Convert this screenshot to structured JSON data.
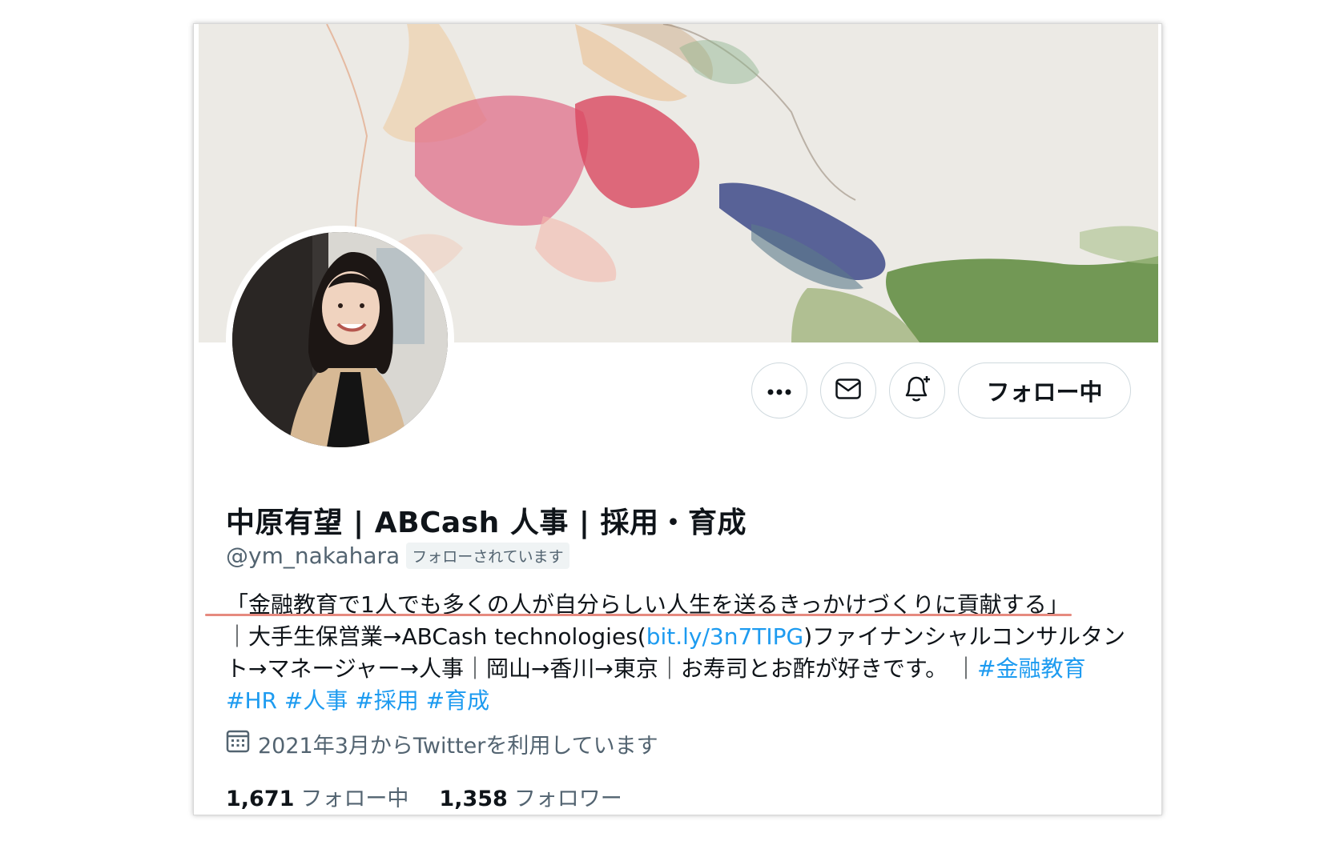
{
  "profile": {
    "display_name": "中原有望 | ABCash 人事 | 採用・育成",
    "handle": "@ym_nakahara",
    "follows_you_badge": "フォローされています",
    "follow_button_label": "フォロー中"
  },
  "actions": {
    "more_icon": "more-horizontal-icon",
    "message_icon": "envelope-icon",
    "notify_icon": "bell-plus-icon"
  },
  "bio": {
    "line1": "「金融教育で1人でも多くの人が自分らしい人生を送るきっかけづくりに貢献する」",
    "text_a": "｜大手生保営業→ABCash technologies(",
    "link": "bit.ly/3n7TIPG",
    "text_b": ")ファイナンシャルコンサルタント→マネージャー→人事｜岡山→香川→東京｜お寿司とお酢が好きです。 ｜",
    "hashtags": [
      "#金融教育",
      "#HR",
      "#人事",
      "#採用",
      "#育成"
    ]
  },
  "joined": {
    "icon": "calendar-icon",
    "text": "2021年3月からTwitterを利用しています"
  },
  "stats": {
    "following_count": "1,671",
    "following_label": "フォロー中",
    "followers_count": "1,358",
    "followers_label": "フォロワー"
  },
  "colors": {
    "link": "#1d9bf0",
    "secondary_text": "#536471",
    "underline_accent": "#e68a7f"
  }
}
